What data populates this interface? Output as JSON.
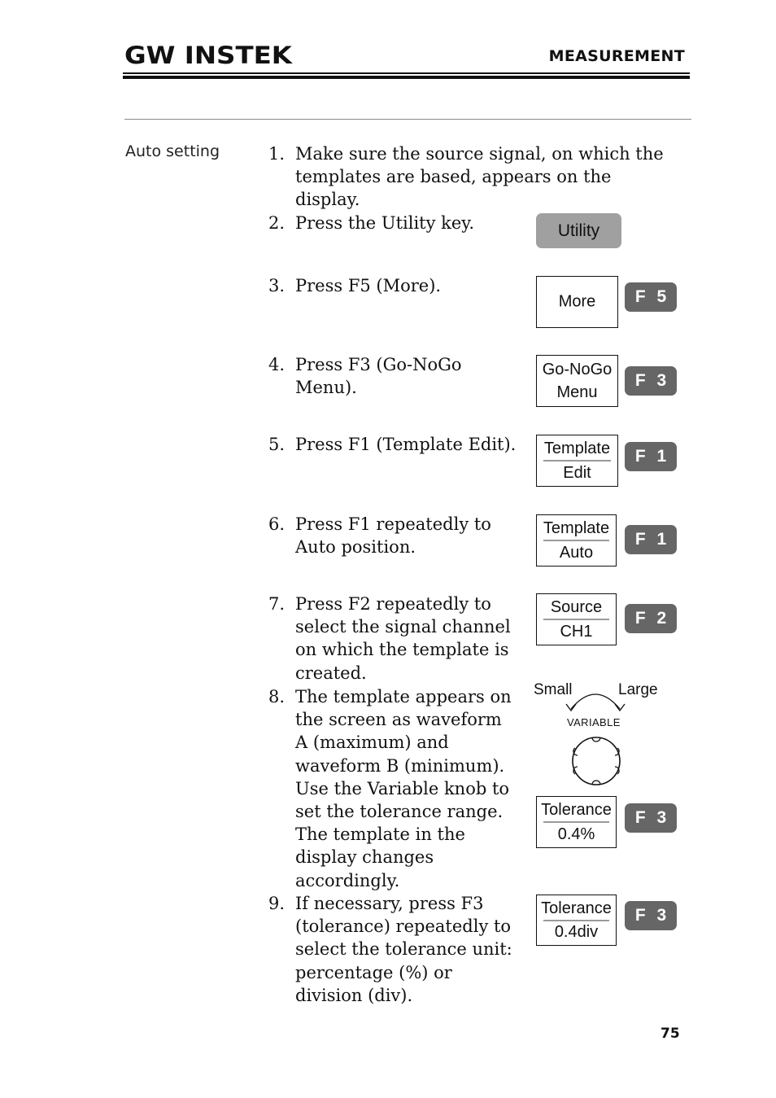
{
  "header": {
    "brand": "GW INSTEK",
    "section_title": "MEASUREMENT"
  },
  "section": {
    "label": "Auto setting"
  },
  "steps": [
    {
      "number": "1.",
      "text": "Make sure the source signal, on which the templates are based, appears on the display."
    },
    {
      "number": "2.",
      "text": "Press the Utility key."
    },
    {
      "number": "3.",
      "text": "Press F5 (More)."
    },
    {
      "number": "4.",
      "text": "Press F3 (Go-NoGo Menu)."
    },
    {
      "number": "5.",
      "text": "Press F1 (Template Edit)."
    },
    {
      "number": "6.",
      "text": "Press F1 repeatedly to Auto position."
    },
    {
      "number": "7.",
      "text": "Press F2 repeatedly to select the signal channel on which the template is created."
    },
    {
      "number": "8.",
      "text": "The template appears on the screen as waveform A (maximum) and waveform B (minimum). Use the Variable knob to set the tolerance range. The template in the display changes accordingly."
    },
    {
      "number": "9.",
      "text": "If necessary, press F3 (tolerance) repeatedly to select the tolerance unit: percentage (%) or division (div)."
    }
  ],
  "keys": {
    "utility": "Utility",
    "more": {
      "label": "More",
      "fkey": "F 5"
    },
    "gonogo": {
      "top": "Go-NoGo",
      "bottom": "Menu",
      "fkey": "F 3"
    },
    "template_edit": {
      "top": "Template",
      "bottom": "Edit",
      "fkey": "F 1"
    },
    "template_auto": {
      "top": "Template",
      "bottom": "Auto",
      "fkey": "F 1"
    },
    "source": {
      "top": "Source",
      "bottom": "CH1",
      "fkey": "F 2"
    },
    "tolerance_pct": {
      "top": "Tolerance",
      "bottom": "0.4%",
      "fkey": "F 3"
    },
    "tolerance_div": {
      "top": "Tolerance",
      "bottom": "0.4div",
      "fkey": "F 3"
    }
  },
  "knob": {
    "left_label": "Small",
    "right_label": "Large",
    "name": "VARIABLE"
  },
  "colors": {
    "fkey_bg": "#666666",
    "utility_bg": "#a0a0a0",
    "divider": "#9a9a9a"
  },
  "footer": {
    "page_number": "75"
  }
}
